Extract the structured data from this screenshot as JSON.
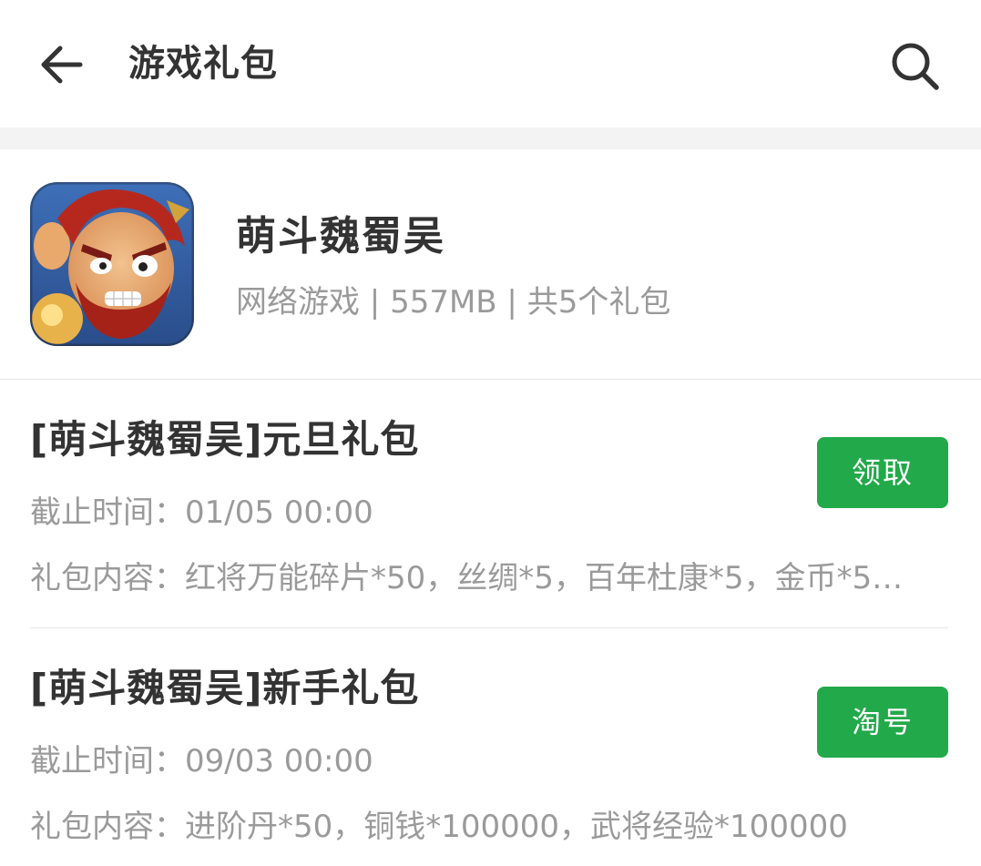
{
  "header": {
    "title": "游戏礼包",
    "back_icon": "arrow-left-icon",
    "search_icon": "search-icon"
  },
  "game": {
    "name": "萌斗魏蜀吴",
    "meta": "网络游戏 | 557MB | 共5个礼包",
    "icon": "game-app-icon"
  },
  "gifts": [
    {
      "title": "[萌斗魏蜀吴]元旦礼包",
      "deadline": "截止时间：01/05 00:00",
      "content": "礼包内容：红将万能碎片*50，丝绸*5，百年杜康*5，金币*5…",
      "button": "领取"
    },
    {
      "title": "[萌斗魏蜀吴]新手礼包",
      "deadline": "截止时间：09/03 00:00",
      "content": "礼包内容：进阶丹*50，铜钱*100000，武将经验*100000",
      "button": "淘号"
    }
  ],
  "colors": {
    "accent": "#22a94a",
    "title_text": "#333333",
    "secondary_text": "#9a9a9a",
    "divider": "#e6e6e6",
    "band": "#f3f3f3"
  }
}
